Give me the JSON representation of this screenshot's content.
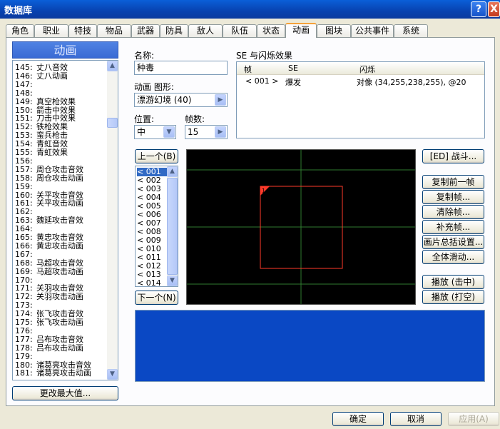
{
  "window": {
    "title": "数据库",
    "help": "?",
    "close": "X"
  },
  "tabs": [
    "角色",
    "职业",
    "特技",
    "物品",
    "武器",
    "防具",
    "敌人",
    "队伍",
    "状态",
    "动画",
    "图块",
    "公共事件",
    "系统"
  ],
  "active_tab_index": 9,
  "left": {
    "header": "动画",
    "items": [
      {
        "num": "145:",
        "name": "丈八音效"
      },
      {
        "num": "146:",
        "name": "丈八动画"
      },
      {
        "num": "147:",
        "name": ""
      },
      {
        "num": "148:",
        "name": ""
      },
      {
        "num": "149:",
        "name": "真空枪效果"
      },
      {
        "num": "150:",
        "name": "箭击中效果"
      },
      {
        "num": "151:",
        "name": "刀击中效果"
      },
      {
        "num": "152:",
        "name": "铁枪效果"
      },
      {
        "num": "153:",
        "name": "蛮兵枪击"
      },
      {
        "num": "154:",
        "name": "青虹音效"
      },
      {
        "num": "155:",
        "name": "青虹效果"
      },
      {
        "num": "156:",
        "name": ""
      },
      {
        "num": "157:",
        "name": "周仓攻击音效"
      },
      {
        "num": "158:",
        "name": "周仓攻击动画"
      },
      {
        "num": "159:",
        "name": ""
      },
      {
        "num": "160:",
        "name": "关平攻击音效"
      },
      {
        "num": "161:",
        "name": "关平攻击动画"
      },
      {
        "num": "162:",
        "name": ""
      },
      {
        "num": "163:",
        "name": "魏延攻击音效"
      },
      {
        "num": "164:",
        "name": ""
      },
      {
        "num": "165:",
        "name": "黄忠攻击音效"
      },
      {
        "num": "166:",
        "name": "黄忠攻击动画"
      },
      {
        "num": "167:",
        "name": ""
      },
      {
        "num": "168:",
        "name": "马超攻击音效"
      },
      {
        "num": "169:",
        "name": "马超攻击动画"
      },
      {
        "num": "170:",
        "name": ""
      },
      {
        "num": "171:",
        "name": "关羽攻击音效"
      },
      {
        "num": "172:",
        "name": "关羽攻击动画"
      },
      {
        "num": "173:",
        "name": ""
      },
      {
        "num": "174:",
        "name": "张飞攻击音效"
      },
      {
        "num": "175:",
        "name": "张飞攻击动画"
      },
      {
        "num": "176:",
        "name": ""
      },
      {
        "num": "177:",
        "name": "吕布攻击音效"
      },
      {
        "num": "178:",
        "name": "吕布攻击动画"
      },
      {
        "num": "179:",
        "name": ""
      },
      {
        "num": "180:",
        "name": "诸葛亮攻击音效"
      },
      {
        "num": "181:",
        "name": "诸葛亮攻击动画"
      }
    ],
    "change_max_button": "更改最大值..."
  },
  "form": {
    "name_label": "名称:",
    "name_value": "种毒",
    "graphic_label": "动画 图形:",
    "graphic_value": "漂游幻境 (40)",
    "position_label": "位置:",
    "position_value": "中",
    "frames_label": "帧数:",
    "frames_value": "15"
  },
  "se": {
    "label": "SE 与闪烁效果",
    "col_frame": "帧",
    "col_se": "SE",
    "col_flash": "闪烁",
    "rows": [
      {
        "frame": "< 001 >",
        "se": "爆发",
        "flash": "对像 (34,255,238,255), @20"
      }
    ]
  },
  "frames": {
    "prev_button": "上一个(B)",
    "next_button": "下一个(N)",
    "items": [
      "< 001",
      "< 002",
      "< 003",
      "< 004",
      "< 005",
      "< 006",
      "< 007",
      "< 008",
      "< 009",
      "< 010",
      "< 011",
      "< 012",
      "< 013",
      "< 014"
    ],
    "selected_index": 0
  },
  "canvas": {
    "cell_label": "1",
    "grid_color": "#2f7a2f",
    "cell_color": "#ff3a2a"
  },
  "side_buttons": {
    "battle": "[ED] 战斗...",
    "copy_prev": "复制前一帧",
    "copy_frame": "复制帧...",
    "clear_frame": "清除帧...",
    "fill_frame": "补充帧...",
    "batch_settings": "画片总括设置...",
    "slide_all": "全体滑动...",
    "play_hit": "播放 (击中)",
    "play_miss": "播放 (打空)"
  },
  "footer": {
    "ok": "确定",
    "cancel": "取消",
    "apply": "应用(A)"
  },
  "colors": {
    "preview_bg": "#0a48c4",
    "header_blue": "#3a6ad4"
  }
}
